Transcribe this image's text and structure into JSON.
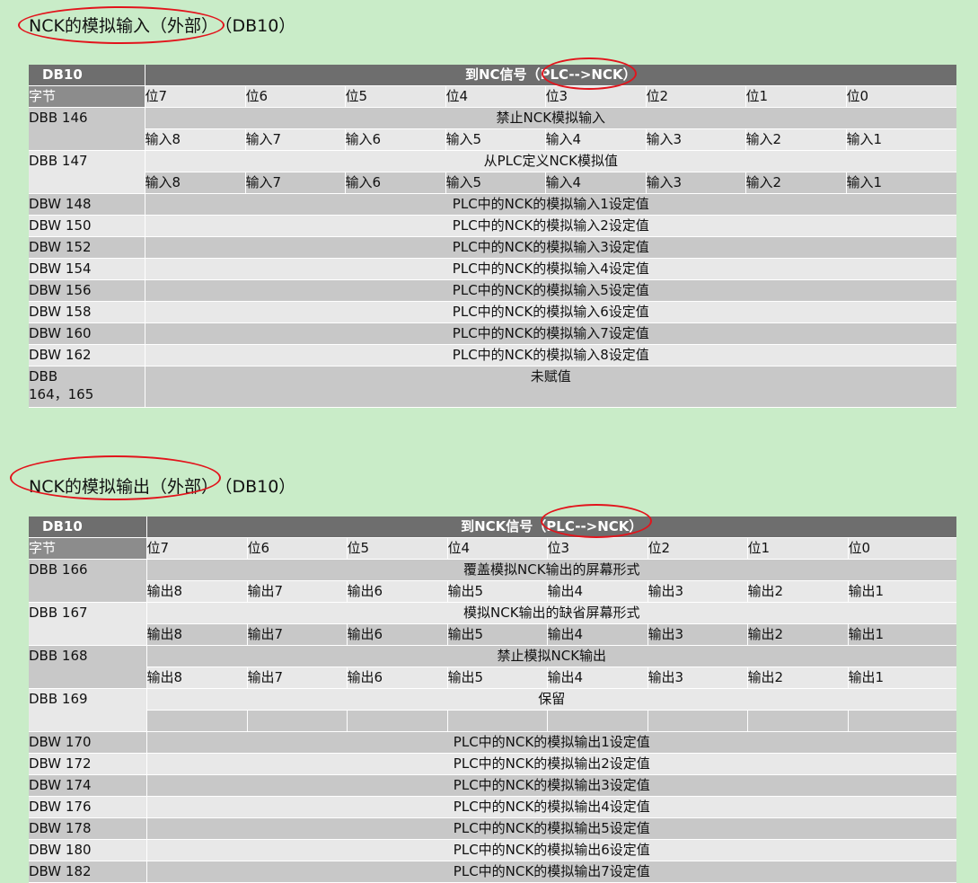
{
  "section1": {
    "title": "NCK的模拟输入（外部）",
    "dbref": "（DB10）",
    "header_db": "DB10",
    "header_signal": "到NC信号（PLC-->NCK）",
    "byte_label": "字节",
    "bits": [
      "位7",
      "位6",
      "位5",
      "位4",
      "位3",
      "位2",
      "位1",
      "位0"
    ],
    "bit_rows": [
      {
        "addr": "DBB 146",
        "title": "禁止NCK模拟输入",
        "cells": [
          "输入8",
          "输入7",
          "输入6",
          "输入5",
          "输入4",
          "输入3",
          "输入2",
          "输入1"
        ]
      },
      {
        "addr": "DBB 147",
        "title": "从PLC定义NCK模拟值",
        "cells": [
          "输入8",
          "输入7",
          "输入6",
          "输入5",
          "输入4",
          "输入3",
          "输入2",
          "输入1"
        ]
      }
    ],
    "word_rows": [
      {
        "addr": "DBW 148",
        "value": "PLC中的NCK的模拟输入1设定值"
      },
      {
        "addr": "DBW 150",
        "value": "PLC中的NCK的模拟输入2设定值"
      },
      {
        "addr": "DBW 152",
        "value": "PLC中的NCK的模拟输入3设定值"
      },
      {
        "addr": "DBW 154",
        "value": "PLC中的NCK的模拟输入4设定值"
      },
      {
        "addr": "DBW 156",
        "value": "PLC中的NCK的模拟输入5设定值"
      },
      {
        "addr": "DBW 158",
        "value": "PLC中的NCK的模拟输入6设定值"
      },
      {
        "addr": "DBW 160",
        "value": "PLC中的NCK的模拟输入7设定值"
      },
      {
        "addr": "DBW 162",
        "value": "PLC中的NCK的模拟输入8设定值"
      }
    ],
    "last_row": {
      "addr_line1": "DBB",
      "addr_line2": "164，165",
      "value": "未赋值"
    }
  },
  "section2": {
    "title": "NCK的模拟输出（外部）",
    "dbref": "（DB10）",
    "header_db": "DB10",
    "header_signal": "到NCK信号（PLC-->NCK）",
    "byte_label": "字节",
    "bits": [
      "位7",
      "位6",
      "位5",
      "位4",
      "位3",
      "位2",
      "位1",
      "位0"
    ],
    "bit_rows": [
      {
        "addr": "DBB 166",
        "title": "覆盖模拟NCK输出的屏幕形式",
        "cells": [
          "输出8",
          "输出7",
          "输出6",
          "输出5",
          "输出4",
          "输出3",
          "输出2",
          "输出1"
        ]
      },
      {
        "addr": "DBB 167",
        "title": "模拟NCK输出的缺省屏幕形式",
        "cells": [
          "输出8",
          "输出7",
          "输出6",
          "输出5",
          "输出4",
          "输出3",
          "输出2",
          "输出1"
        ]
      },
      {
        "addr": "DBB 168",
        "title": "禁止模拟NCK输出",
        "cells": [
          "输出8",
          "输出7",
          "输出6",
          "输出5",
          "输出4",
          "输出3",
          "输出2",
          "输出1"
        ]
      },
      {
        "addr": "DBB 169",
        "title": "保留",
        "cells": [
          "",
          "",
          "",
          "",
          "",
          "",
          "",
          ""
        ]
      }
    ],
    "word_rows": [
      {
        "addr": "DBW 170",
        "value": "PLC中的NCK的模拟输出1设定值"
      },
      {
        "addr": "DBW 172",
        "value": "PLC中的NCK的模拟输出2设定值"
      },
      {
        "addr": "DBW 174",
        "value": "PLC中的NCK的模拟输出3设定值"
      },
      {
        "addr": "DBW 176",
        "value": "PLC中的NCK的模拟输出4设定值"
      },
      {
        "addr": "DBW 178",
        "value": "PLC中的NCK的模拟输出5设定值"
      },
      {
        "addr": "DBW 180",
        "value": "PLC中的NCK的模拟输出6设定值"
      },
      {
        "addr": "DBW 182",
        "value": "PLC中的NCK的模拟输出7设定值"
      }
    ]
  },
  "annotation_color": "#e2141c"
}
